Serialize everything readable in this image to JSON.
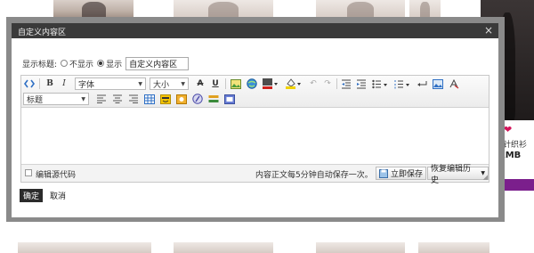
{
  "dialog": {
    "title": "自定义内容区",
    "close_glyph": "×"
  },
  "show_title": {
    "label": "显示标题:",
    "option_hide": "不显示",
    "option_show": "显示",
    "selected": "显示",
    "input_value": "自定义内容区"
  },
  "toolbar": {
    "font_family": "字体",
    "font_size": "大小",
    "paragraph": "标题"
  },
  "statusbar": {
    "source_label": "编辑源代码",
    "autosave_text": "内容正文每5分钟自动保存一次。",
    "save_button": "立即保存",
    "history_button": "恢复编辑历史"
  },
  "footer": {
    "ok": "确定",
    "cancel": "取消"
  },
  "background": {
    "text_a": "羊针织衫",
    "text_b": "RMB",
    "heart": "❤"
  }
}
